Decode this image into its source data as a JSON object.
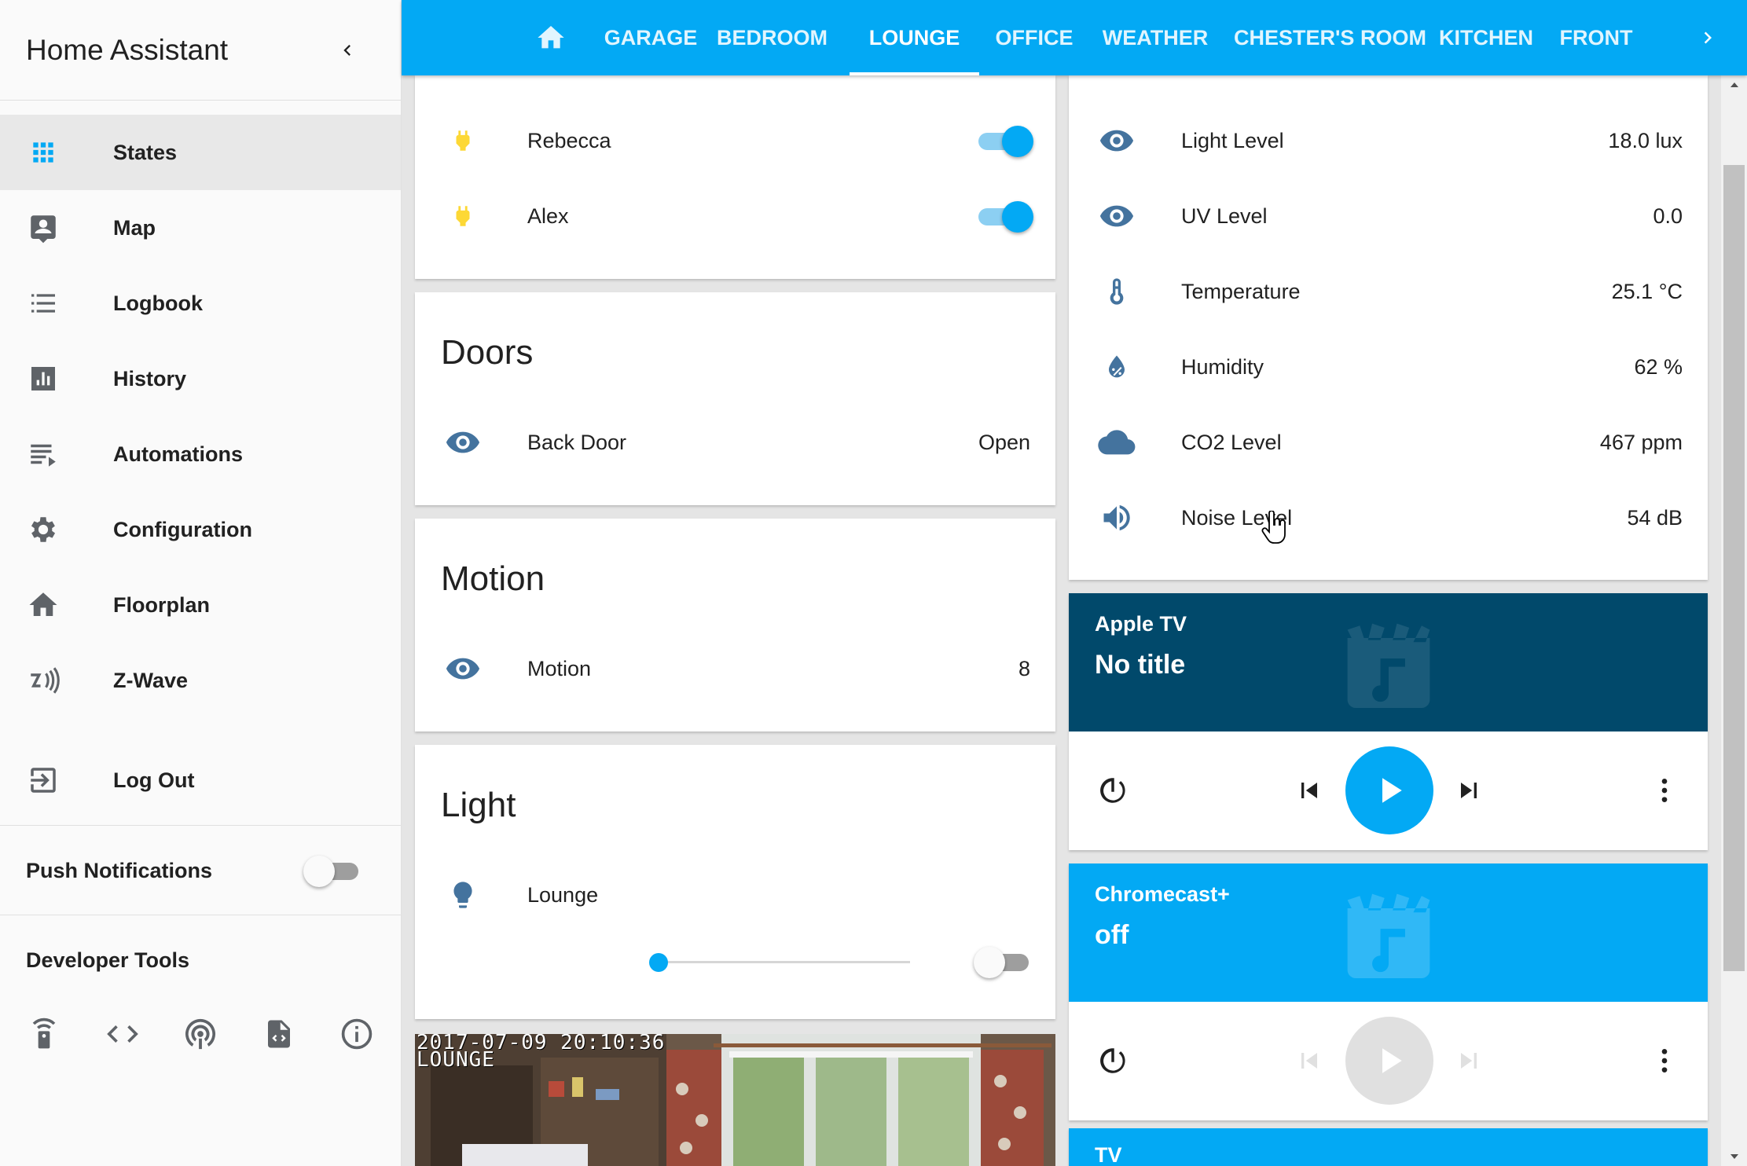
{
  "app": {
    "title": "Home Assistant"
  },
  "sidebar": {
    "items": [
      {
        "label": "States",
        "icon": "grid-icon"
      },
      {
        "label": "Map",
        "icon": "account-box-icon"
      },
      {
        "label": "Logbook",
        "icon": "list-icon"
      },
      {
        "label": "History",
        "icon": "chart-icon"
      },
      {
        "label": "Automations",
        "icon": "playlist-play-icon"
      },
      {
        "label": "Configuration",
        "icon": "gear-icon"
      },
      {
        "label": "Floorplan",
        "icon": "home-icon"
      },
      {
        "label": "Z-Wave",
        "icon": "z-wave-icon"
      }
    ],
    "logout_label": "Log Out",
    "push_label": "Push Notifications",
    "push_enabled": false,
    "dev_tools_label": "Developer Tools",
    "dev_tools": [
      "remote-icon",
      "code-icon",
      "broadcast-icon",
      "file-code-icon",
      "info-icon"
    ]
  },
  "tabs": [
    "GARAGE",
    "BEDROOM",
    "LOUNGE",
    "OFFICE",
    "WEATHER",
    "CHESTER'S ROOM",
    "KITCHEN",
    "FRONT"
  ],
  "active_tab": "LOUNGE",
  "switches": [
    {
      "name": "Rebecca",
      "icon": "power-plug-icon",
      "on": true
    },
    {
      "name": "Alex",
      "icon": "power-plug-icon",
      "on": true
    }
  ],
  "doors": {
    "title": "Doors",
    "rows": [
      {
        "name": "Back Door",
        "value": "Open",
        "icon": "eye-icon"
      }
    ]
  },
  "motion": {
    "title": "Motion",
    "rows": [
      {
        "name": "Motion",
        "value": "8",
        "icon": "eye-icon"
      }
    ]
  },
  "light": {
    "title": "Light",
    "rows": [
      {
        "name": "Lounge",
        "icon": "lightbulb-icon",
        "brightness": 0,
        "on": false
      }
    ]
  },
  "sensors": [
    {
      "name": "Light Level",
      "value": "18.0 lux",
      "icon": "eye-icon"
    },
    {
      "name": "UV Level",
      "value": "0.0",
      "icon": "eye-icon"
    },
    {
      "name": "Temperature",
      "value": "25.1 °C",
      "icon": "thermometer-icon"
    },
    {
      "name": "Humidity",
      "value": "62 %",
      "icon": "water-percent-icon"
    },
    {
      "name": "CO2 Level",
      "value": "467 ppm",
      "icon": "cloud-icon"
    },
    {
      "name": "Noise Level",
      "value": "54 dB",
      "icon": "volume-icon"
    }
  ],
  "media": [
    {
      "name": "Apple TV",
      "title": "No title",
      "state": "idle",
      "color": "#01496b"
    },
    {
      "name": "Chromecast+",
      "title": "off",
      "state": "off",
      "color": "#03a9f4"
    },
    {
      "name": "TV",
      "title": "",
      "state": "",
      "color": "#03a9f4"
    }
  ],
  "camera": {
    "timestamp": "2017-07-09 20:10:36",
    "label": "LOUNGE"
  },
  "colors": {
    "primary": "#03a9f4",
    "icon": "#44739e",
    "plug": "#fdd835"
  }
}
